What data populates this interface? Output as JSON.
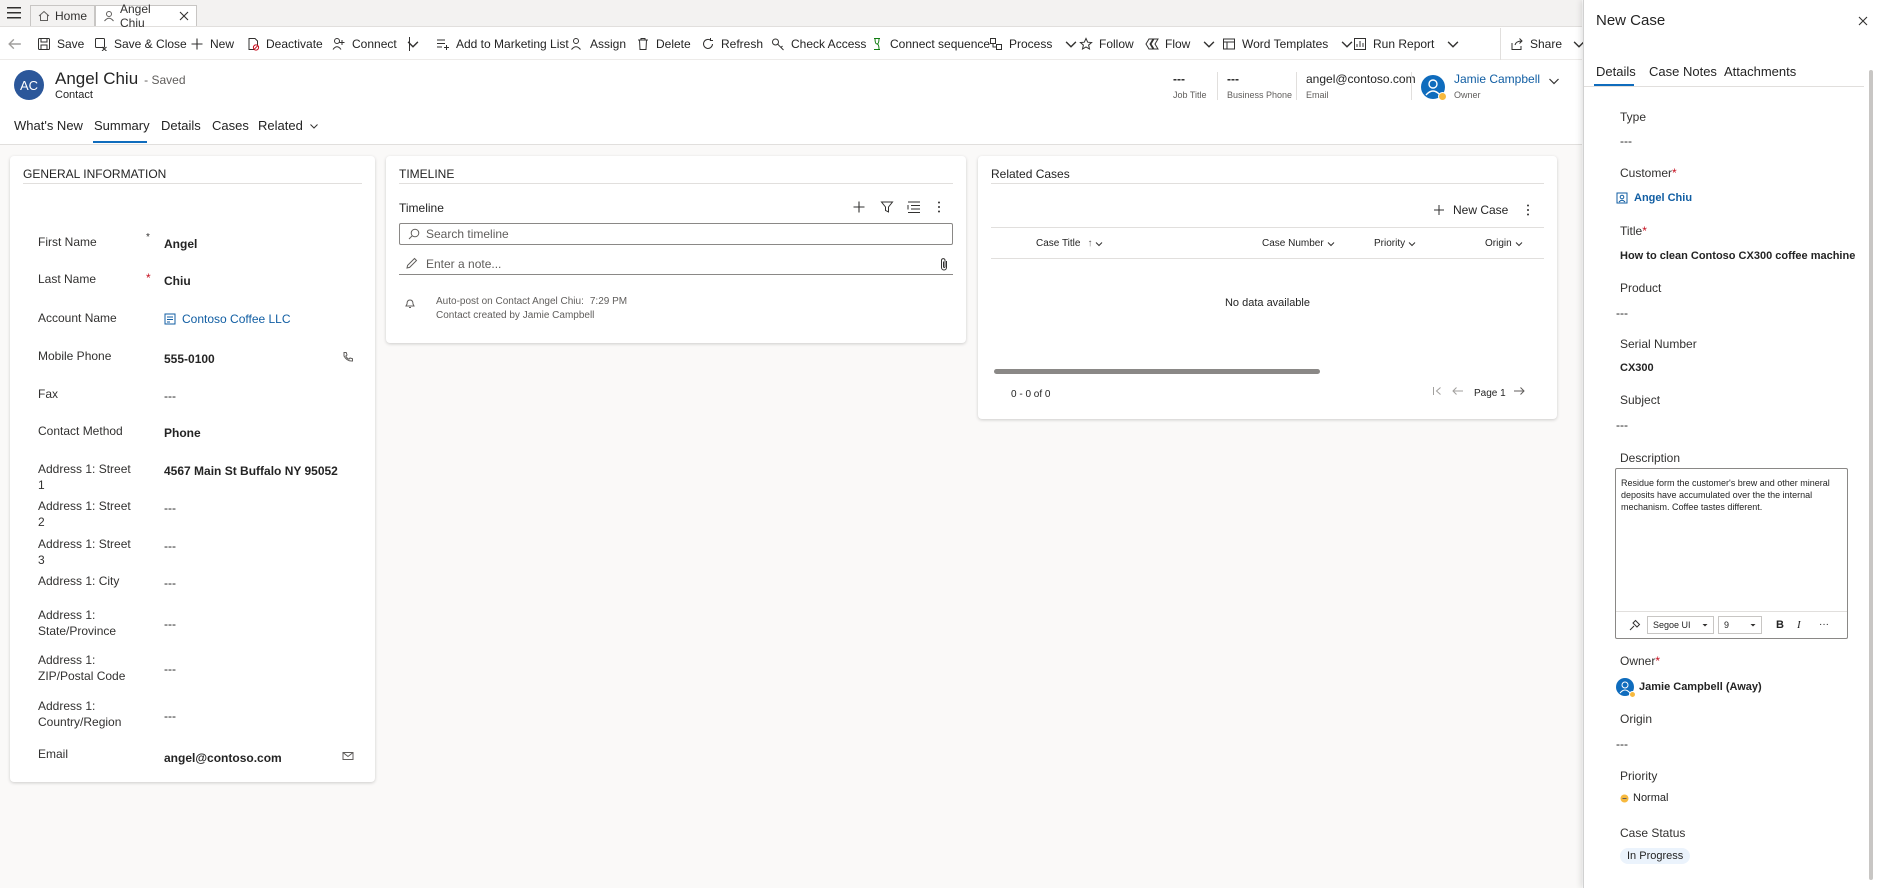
{
  "tabs": {
    "home": "Home",
    "record": "Angel Chiu"
  },
  "commands": {
    "save": "Save",
    "save_close": "Save & Close",
    "new": "New",
    "deactivate": "Deactivate",
    "connect": "Connect",
    "add_marketing": "Add to Marketing List",
    "assign": "Assign",
    "delete": "Delete",
    "refresh": "Refresh",
    "check_access": "Check Access",
    "connect_sequence": "Connect sequence",
    "process": "Process",
    "follow": "Follow",
    "flow": "Flow",
    "word_templates": "Word Templates",
    "run_report": "Run Report",
    "share": "Share"
  },
  "record": {
    "initials": "AC",
    "name": "Angel Chiu",
    "saved_status": "- Saved",
    "entity": "Contact",
    "job_title_value": "---",
    "job_title_label": "Job Title",
    "business_phone_value": "---",
    "business_phone_label": "Business Phone",
    "email_value": "angel@contoso.com",
    "email_label": "Email",
    "owner_name": "Jamie Campbell",
    "owner_label": "Owner"
  },
  "subtabs": [
    "What's New",
    "Summary",
    "Details",
    "Cases",
    "Related"
  ],
  "general": {
    "title": "GENERAL INFORMATION",
    "fields": [
      {
        "label": "First Name",
        "value": "Angel"
      },
      {
        "label": "Last Name",
        "value": "Chiu"
      },
      {
        "label": "Account Name",
        "value": "Contoso Coffee LLC"
      },
      {
        "label": "Mobile Phone",
        "value": "555-0100"
      },
      {
        "label": "Fax",
        "value": "---"
      },
      {
        "label": "Contact Method",
        "value": "Phone"
      },
      {
        "label": "Address 1: Street 1",
        "value": "4567 Main St Buffalo NY 95052"
      },
      {
        "label": "Address 1: Street 2",
        "value": "---"
      },
      {
        "label": "Address 1: Street 3",
        "value": "---"
      },
      {
        "label": "Address 1: City",
        "value": "---"
      },
      {
        "label": "Address 1: State/Province",
        "value": "---"
      },
      {
        "label": "Address 1: ZIP/Postal Code",
        "value": "---"
      },
      {
        "label": "Address 1: Country/Region",
        "value": "---"
      },
      {
        "label": "Email",
        "value": "angel@contoso.com"
      }
    ],
    "required_mark": "*"
  },
  "timeline": {
    "section_title": "TIMELINE",
    "header": "Timeline",
    "search_placeholder": "Search timeline",
    "note_placeholder": "Enter a note...",
    "post_text": "Auto-post on Contact Angel Chiu:",
    "post_time": "7:29 PM",
    "post_body": "Contact created by Jamie Campbell"
  },
  "related_cases": {
    "title": "Related Cases",
    "new_case": "New Case",
    "columns": [
      "Case Title",
      "Case Number",
      "Priority",
      "Origin"
    ],
    "sort_arrow": "↑",
    "empty": "No data available",
    "count": "0 - 0 of 0",
    "page": "Page 1"
  },
  "new_case": {
    "title": "New Case",
    "tabs": [
      "Details",
      "Case Notes",
      "Attachments"
    ],
    "type_label": "Type",
    "type_value": "---",
    "customer_label": "Customer",
    "customer_value": "Angel Chiu",
    "title_label": "Title",
    "title_value": "How to clean Contoso CX300 coffee machine",
    "product_label": "Product",
    "product_value": "---",
    "serial_label": "Serial Number",
    "serial_value": "CX300",
    "subject_label": "Subject",
    "subject_value": "---",
    "description_label": "Description",
    "description_value": "Residue form the customer's brew and other mineral deposits have accumulated over the the internal mechanism. Coffee tastes different.",
    "font_name": "Segoe UI",
    "font_size": "9",
    "bold": "B",
    "italic": "I",
    "more": "···",
    "owner_label": "Owner",
    "owner_value": "Jamie Campbell (Away)",
    "origin_label": "Origin",
    "origin_value": "---",
    "priority_label": "Priority",
    "priority_value": "Normal",
    "status_label": "Case Status",
    "status_value": "In Progress",
    "required_mark": "*"
  },
  "colors": {
    "accent": "#0f6cbd",
    "link": "#115ea3",
    "avatar": "#2b579a",
    "required": "#c50f1f",
    "away": "#f7b93e",
    "status_bg": "#ebf3fc"
  }
}
